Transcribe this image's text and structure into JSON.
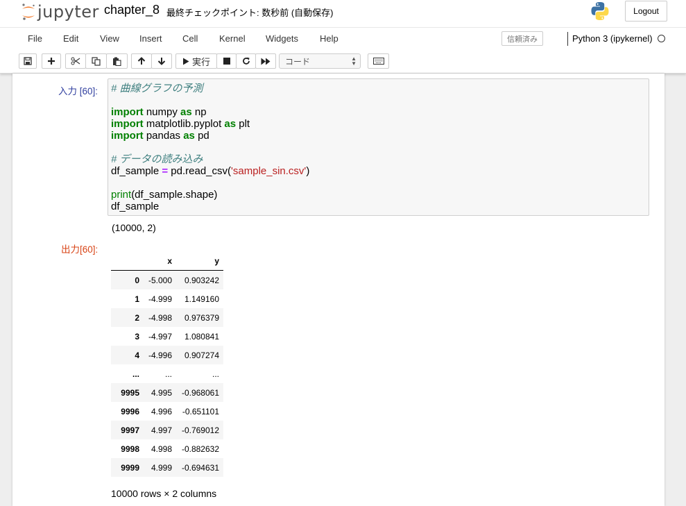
{
  "header": {
    "logo_text": "jupyter",
    "notebook_name": "chapter_8",
    "checkpoint": "最終チェックポイント: 数秒前 (自動保存)",
    "logout_label": "Logout"
  },
  "menubar": {
    "items": [
      "File",
      "Edit",
      "View",
      "Insert",
      "Cell",
      "Kernel",
      "Widgets",
      "Help"
    ],
    "trusted": "信頼済み",
    "kernel": "Python 3 (ipykernel)"
  },
  "toolbar": {
    "run_label": "実行",
    "cell_type": "コード"
  },
  "cell": {
    "in_prompt": "入力 [60]:",
    "code_lines": [
      [
        {
          "t": "# 曲線グラフの予測",
          "c": "comment"
        }
      ],
      [],
      [
        {
          "t": "import",
          "c": "keyword"
        },
        {
          "t": " numpy ",
          "c": ""
        },
        {
          "t": "as",
          "c": "keyword"
        },
        {
          "t": " np",
          "c": ""
        }
      ],
      [
        {
          "t": "import",
          "c": "keyword"
        },
        {
          "t": " matplotlib.pyplot ",
          "c": ""
        },
        {
          "t": "as",
          "c": "keyword"
        },
        {
          "t": " plt",
          "c": ""
        }
      ],
      [
        {
          "t": "import",
          "c": "keyword"
        },
        {
          "t": " pandas ",
          "c": ""
        },
        {
          "t": "as",
          "c": "keyword"
        },
        {
          "t": " pd",
          "c": ""
        }
      ],
      [],
      [
        {
          "t": "# データの読み込み",
          "c": "comment"
        }
      ],
      [
        {
          "t": "df_sample ",
          "c": ""
        },
        {
          "t": "=",
          "c": "operator"
        },
        {
          "t": " pd.read_csv(",
          "c": ""
        },
        {
          "t": "'sample_sin.csv'",
          "c": "string"
        },
        {
          "t": ")",
          "c": ""
        }
      ],
      [],
      [
        {
          "t": "print",
          "c": "builtin"
        },
        {
          "t": "(df_sample.shape)",
          "c": ""
        }
      ],
      [
        {
          "t": "df_sample",
          "c": ""
        }
      ]
    ],
    "stdout": "(10000, 2)",
    "out_prompt": "出力[60]:"
  },
  "dataframe": {
    "columns": [
      "",
      "x",
      "y"
    ],
    "rows": [
      [
        "0",
        "-5.000",
        "0.903242"
      ],
      [
        "1",
        "-4.999",
        "1.149160"
      ],
      [
        "2",
        "-4.998",
        "0.976379"
      ],
      [
        "3",
        "-4.997",
        "1.080841"
      ],
      [
        "4",
        "-4.996",
        "0.907274"
      ],
      [
        "...",
        "...",
        "..."
      ],
      [
        "9995",
        "4.995",
        "-0.968061"
      ],
      [
        "9996",
        "4.996",
        "-0.651101"
      ],
      [
        "9997",
        "4.997",
        "-0.769012"
      ],
      [
        "9998",
        "4.998",
        "-0.882632"
      ],
      [
        "9999",
        "4.999",
        "-0.694631"
      ]
    ],
    "dimensions": "10000 rows × 2 columns"
  },
  "colors": {
    "in_prompt": "#303f9f",
    "out_prompt": "#d84315",
    "keyword": "#008000",
    "comment": "#408080",
    "string": "#ba2121",
    "operator": "#aa22ff"
  }
}
